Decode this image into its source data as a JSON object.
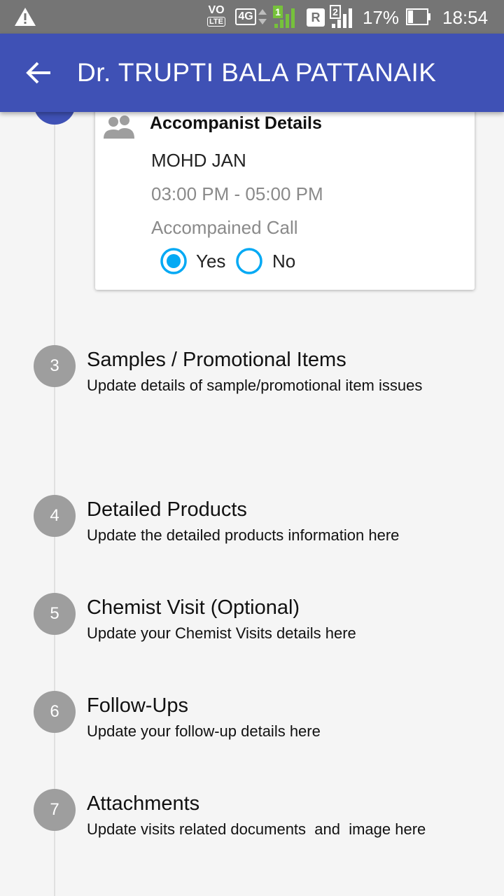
{
  "status_bar": {
    "volte_top": "VO",
    "volte_bottom": "LTE",
    "network": "4G",
    "sim1_label": "1",
    "roaming": "R",
    "sim2_label": "2",
    "battery_percent": "17%",
    "time": "18:54"
  },
  "app_bar": {
    "title": "Dr. TRUPTI BALA PATTANAIK"
  },
  "accompanist_card": {
    "title": "Accompanist Details",
    "name": "MOHD JAN",
    "time_range": "03:00 PM - 05:00 PM",
    "accompanied_label": "Accompained Call",
    "options": [
      {
        "label": "Yes",
        "selected": true
      },
      {
        "label": "No",
        "selected": false
      }
    ]
  },
  "steps": [
    {
      "number": "3",
      "title": "Samples / Promotional Items",
      "subtitle": "Update details of sample/promotional item issues"
    },
    {
      "number": "4",
      "title": "Detailed Products",
      "subtitle": "Update the detailed products information here"
    },
    {
      "number": "5",
      "title": "Chemist Visit (Optional)",
      "subtitle": "Update your Chemist Visits details here"
    },
    {
      "number": "6",
      "title": "Follow-Ups",
      "subtitle": "Update your follow-up details here"
    },
    {
      "number": "7",
      "title": "Attachments",
      "subtitle": "Update visits related documents  and  image here"
    }
  ],
  "colors": {
    "app_bar": "#3f51b5",
    "status_bar": "#757575",
    "radio_accent": "#03a9f4",
    "step_inactive": "#9e9e9e",
    "signal_green": "#76c13b"
  }
}
